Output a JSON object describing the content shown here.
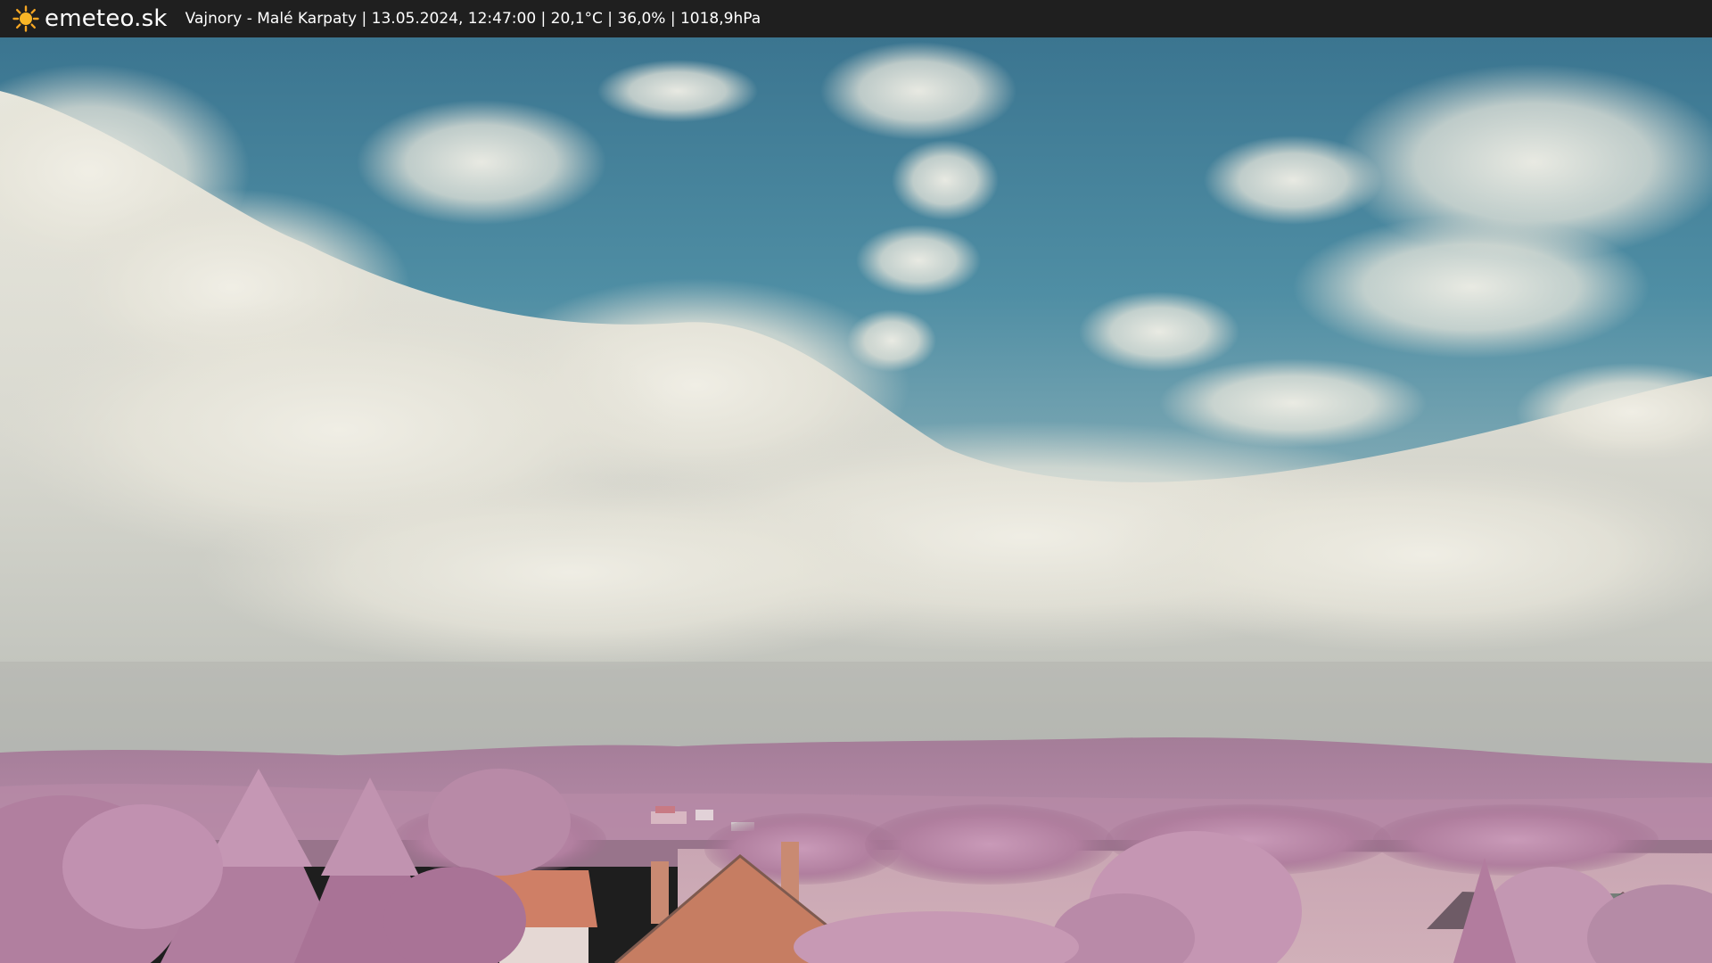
{
  "header": {
    "brand": "emeteo.sk",
    "brand_icon": "sun-icon",
    "caption": "Vajnory - Malé Karpaty | 13.05.2024, 12:47:00 | 20,1°C | 36,0% | 1018,9hPa"
  },
  "webcam": {
    "colors": {
      "sky_top": "#3d7892",
      "sky_mid": "#5a95a9",
      "cloud": "#e8e6dc",
      "hills": "#a87f9c",
      "foliage": "#c596b3",
      "roof": "#d0826a"
    }
  }
}
